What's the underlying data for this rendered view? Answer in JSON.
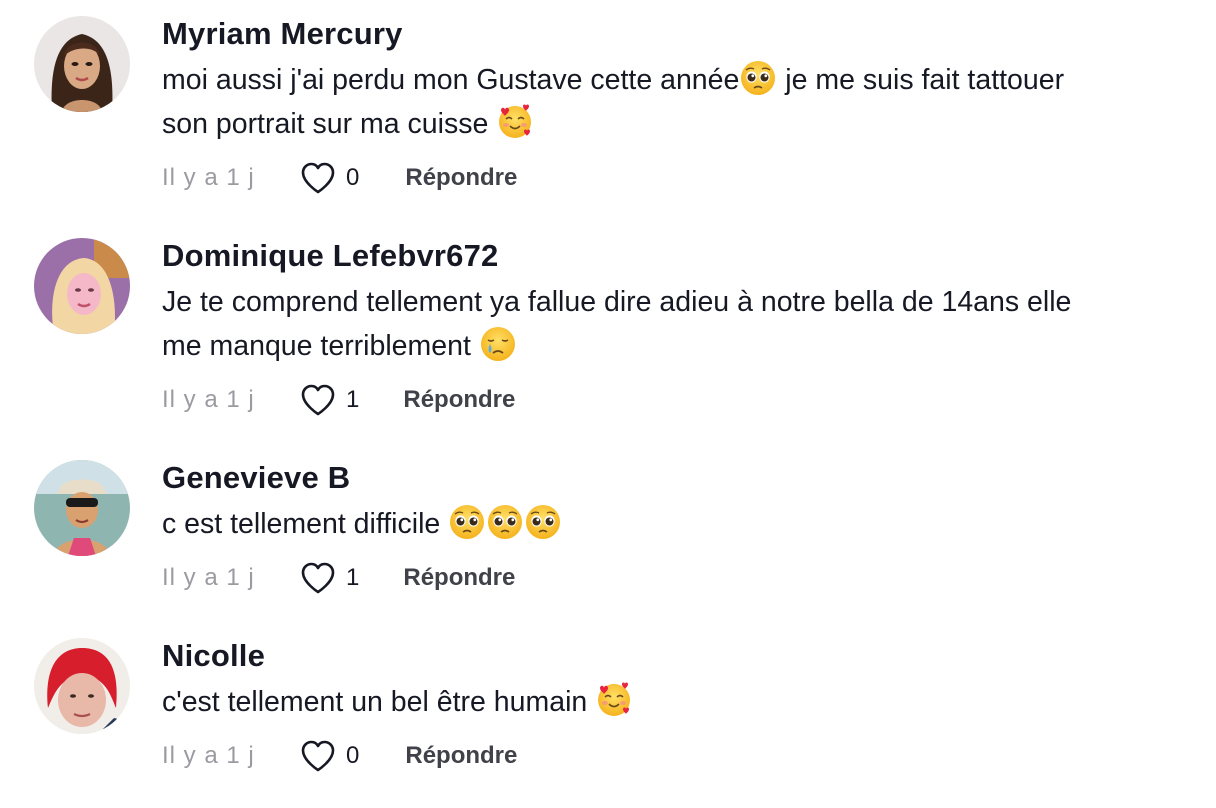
{
  "comments": [
    {
      "username": "Myriam Mercury",
      "text_parts": [
        "moi aussi j'ai perdu mon Gustave cette année",
        " je me suis fait tattouer",
        "son portrait sur ma cuisse "
      ],
      "emojis": [
        "pleading-face-emoji",
        "smiling-face-with-hearts-emoji"
      ],
      "time": "Il y a 1 j",
      "likes": "0",
      "reply_label": "Répondre"
    },
    {
      "username": "Dominique Lefebvr672",
      "text_parts": [
        "Je te comprend tellement ya fallue dire adieu à notre bella de 14ans elle",
        "me manque terriblement "
      ],
      "emojis": [
        "crying-face-emoji"
      ],
      "time": "Il y a 1 j",
      "likes": "1",
      "reply_label": "Répondre"
    },
    {
      "username": "Genevieve B",
      "text_parts": [
        "c est tellement difficile "
      ],
      "emojis": [
        "pleading-face-emoji",
        "pleading-face-emoji",
        "pleading-face-emoji"
      ],
      "time": "Il y a 1 j",
      "likes": "1",
      "reply_label": "Répondre"
    },
    {
      "username": "Nicolle",
      "text_parts": [
        "c'est tellement un bel être humain "
      ],
      "emojis": [
        "smiling-face-with-hearts-emoji"
      ],
      "time": "Il y a 1 j",
      "likes": "0",
      "reply_label": "Répondre"
    }
  ],
  "icons": {
    "like": "heart-outline-icon"
  },
  "colors": {
    "text": "#161823",
    "muted": "#9a9ba1",
    "reply": "#404149"
  }
}
